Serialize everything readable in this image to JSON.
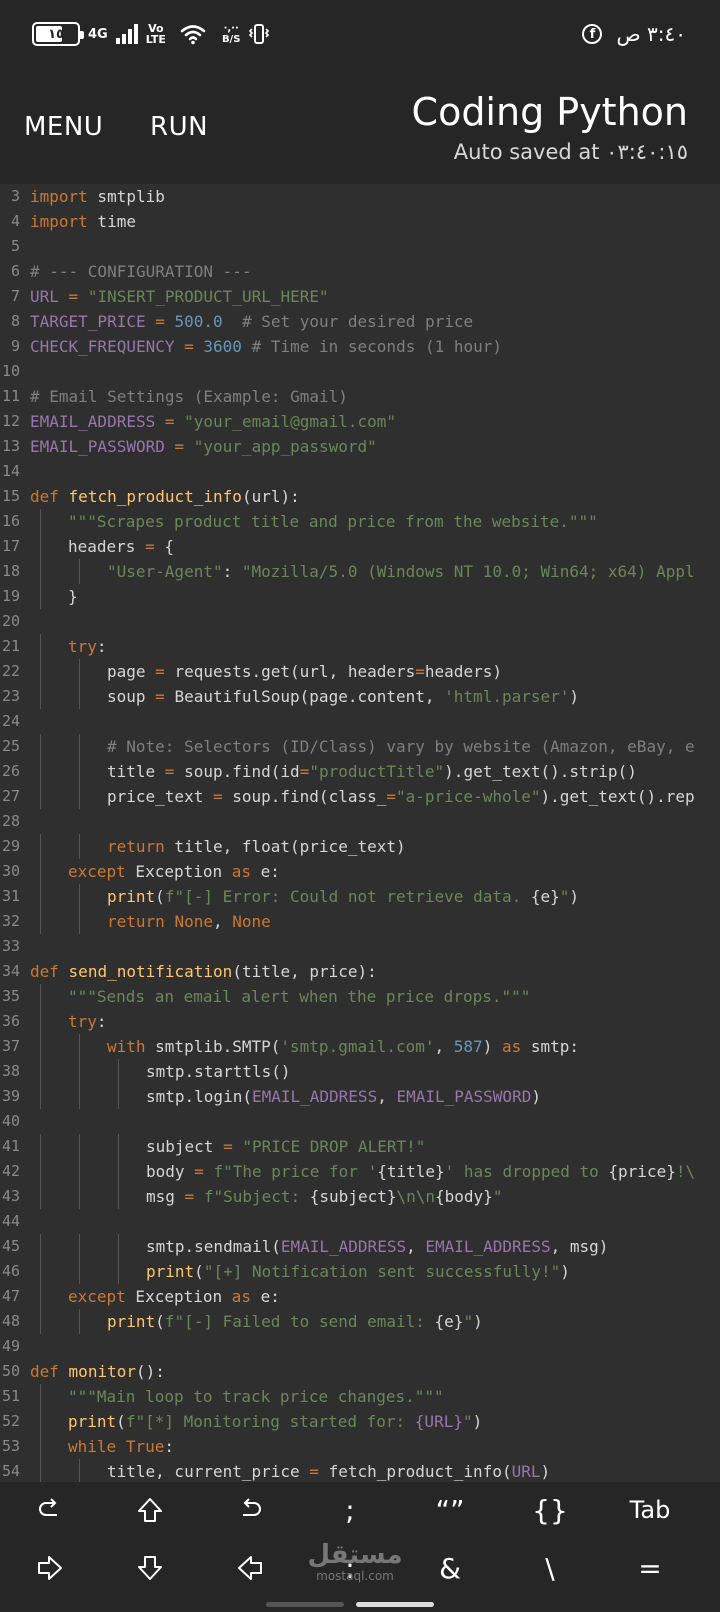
{
  "status_bar": {
    "battery": "١٥",
    "network": "4G",
    "volte_top": "Vo",
    "volte_bottom": "LTE",
    "speed_top": "·,··",
    "speed_bottom": "B/S",
    "time": "٣:٤٠ ص"
  },
  "app_bar": {
    "menu_label": "MENU",
    "run_label": "RUN",
    "title": "Coding Python",
    "subtitle": "Auto saved at ٠٣:٤٠:١٥"
  },
  "editor": {
    "lines": [
      {
        "n": "3",
        "i": 0,
        "t": [
          [
            "kw",
            "import"
          ],
          [
            "p",
            " smtplib"
          ]
        ]
      },
      {
        "n": "4",
        "i": 0,
        "t": [
          [
            "kw",
            "import"
          ],
          [
            "p",
            " time"
          ]
        ]
      },
      {
        "n": "5",
        "i": 0,
        "t": []
      },
      {
        "n": "6",
        "i": 0,
        "t": [
          [
            "cm",
            "# --- CONFIGURATION ---"
          ]
        ]
      },
      {
        "n": "7",
        "i": 0,
        "t": [
          [
            "const",
            "URL"
          ],
          [
            "op",
            " = "
          ],
          [
            "str",
            "\"INSERT_PRODUCT_URL_HERE\""
          ]
        ]
      },
      {
        "n": "8",
        "i": 0,
        "t": [
          [
            "const",
            "TARGET_PRICE"
          ],
          [
            "op",
            " = "
          ],
          [
            "num",
            "500.0"
          ],
          [
            "cm",
            "  # Set your desired price"
          ]
        ]
      },
      {
        "n": "9",
        "i": 0,
        "t": [
          [
            "const",
            "CHECK_FREQUENCY"
          ],
          [
            "op",
            " = "
          ],
          [
            "num",
            "3600"
          ],
          [
            "cm",
            " # Time in seconds (1 hour)"
          ]
        ]
      },
      {
        "n": "10",
        "i": 0,
        "t": []
      },
      {
        "n": "11",
        "i": 0,
        "t": [
          [
            "cm",
            "# Email Settings (Example: Gmail)"
          ]
        ]
      },
      {
        "n": "12",
        "i": 0,
        "t": [
          [
            "const",
            "EMAIL_ADDRESS"
          ],
          [
            "op",
            " = "
          ],
          [
            "str",
            "\"your_email@gmail.com\""
          ]
        ]
      },
      {
        "n": "13",
        "i": 0,
        "t": [
          [
            "const",
            "EMAIL_PASSWORD"
          ],
          [
            "op",
            " = "
          ],
          [
            "str",
            "\"your_app_password\""
          ]
        ]
      },
      {
        "n": "14",
        "i": 0,
        "t": []
      },
      {
        "n": "15",
        "i": 0,
        "t": [
          [
            "kw",
            "def"
          ],
          [
            "p",
            " "
          ],
          [
            "fn",
            "fetch_product_info"
          ],
          [
            "p",
            "(url):"
          ]
        ]
      },
      {
        "n": "16",
        "i": 1,
        "t": [
          [
            "str",
            "\"\"\"Scrapes product title and price from the website.\"\"\""
          ]
        ]
      },
      {
        "n": "17",
        "i": 1,
        "t": [
          [
            "p",
            "headers"
          ],
          [
            "op",
            " = "
          ],
          [
            "p",
            "{"
          ]
        ]
      },
      {
        "n": "18",
        "i": 2,
        "t": [
          [
            "str",
            "\"User-Agent\""
          ],
          [
            "p",
            ": "
          ],
          [
            "str",
            "\"Mozilla/5.0 (Windows NT 10.0; Win64; x64) Appl"
          ]
        ]
      },
      {
        "n": "19",
        "i": 1,
        "t": [
          [
            "p",
            "}"
          ]
        ]
      },
      {
        "n": "20",
        "i": 0,
        "t": []
      },
      {
        "n": "21",
        "i": 1,
        "t": [
          [
            "kw",
            "try"
          ],
          [
            "p",
            ":"
          ]
        ]
      },
      {
        "n": "22",
        "i": 2,
        "t": [
          [
            "p",
            "page"
          ],
          [
            "op",
            " = "
          ],
          [
            "p",
            "requests.get(url, headers"
          ],
          [
            "op",
            "="
          ],
          [
            "p",
            "headers)"
          ]
        ]
      },
      {
        "n": "23",
        "i": 2,
        "t": [
          [
            "p",
            "soup"
          ],
          [
            "op",
            " = "
          ],
          [
            "p",
            "BeautifulSoup(page.content, "
          ],
          [
            "str",
            "'html.parser'"
          ],
          [
            "p",
            ")"
          ]
        ]
      },
      {
        "n": "24",
        "i": 0,
        "t": []
      },
      {
        "n": "25",
        "i": 2,
        "t": [
          [
            "cm",
            "# Note: Selectors (ID/Class) vary by website (Amazon, eBay, e"
          ]
        ]
      },
      {
        "n": "26",
        "i": 2,
        "t": [
          [
            "p",
            "title"
          ],
          [
            "op",
            " = "
          ],
          [
            "p",
            "soup.find(id"
          ],
          [
            "op",
            "="
          ],
          [
            "str",
            "\"productTitle\""
          ],
          [
            "p",
            ").get_text().strip()"
          ]
        ]
      },
      {
        "n": "27",
        "i": 2,
        "t": [
          [
            "p",
            "price_text"
          ],
          [
            "op",
            " = "
          ],
          [
            "p",
            "soup.find(class_"
          ],
          [
            "op",
            "="
          ],
          [
            "str",
            "\"a-price-whole\""
          ],
          [
            "p",
            ").get_text().rep"
          ]
        ]
      },
      {
        "n": "28",
        "i": 0,
        "t": []
      },
      {
        "n": "29",
        "i": 2,
        "t": [
          [
            "kw",
            "return"
          ],
          [
            "p",
            " title, float(price_text)"
          ]
        ]
      },
      {
        "n": "30",
        "i": 1,
        "t": [
          [
            "kw",
            "except"
          ],
          [
            "p",
            " Exception "
          ],
          [
            "kw",
            "as"
          ],
          [
            "p",
            " e:"
          ]
        ]
      },
      {
        "n": "31",
        "i": 2,
        "t": [
          [
            "fn",
            "print"
          ],
          [
            "p",
            "("
          ],
          [
            "str",
            "f\"[-] Error: Could not retrieve data. "
          ],
          [
            "p",
            "{e}"
          ],
          [
            "str",
            "\""
          ],
          [
            "p",
            ")"
          ]
        ]
      },
      {
        "n": "32",
        "i": 2,
        "t": [
          [
            "kw",
            "return"
          ],
          [
            "p",
            " "
          ],
          [
            "kw",
            "None"
          ],
          [
            "p",
            ", "
          ],
          [
            "kw",
            "None"
          ]
        ]
      },
      {
        "n": "33",
        "i": 0,
        "t": []
      },
      {
        "n": "34",
        "i": 0,
        "t": [
          [
            "kw",
            "def"
          ],
          [
            "p",
            " "
          ],
          [
            "fn",
            "send_notification"
          ],
          [
            "p",
            "(title, price):"
          ]
        ]
      },
      {
        "n": "35",
        "i": 1,
        "t": [
          [
            "str",
            "\"\"\"Sends an email alert when the price drops.\"\"\""
          ]
        ]
      },
      {
        "n": "36",
        "i": 1,
        "t": [
          [
            "kw",
            "try"
          ],
          [
            "p",
            ":"
          ]
        ]
      },
      {
        "n": "37",
        "i": 2,
        "t": [
          [
            "kw",
            "with"
          ],
          [
            "p",
            " smtplib.SMTP("
          ],
          [
            "str",
            "'smtp.gmail.com'"
          ],
          [
            "p",
            ", "
          ],
          [
            "num",
            "587"
          ],
          [
            "p",
            ") "
          ],
          [
            "kw",
            "as"
          ],
          [
            "p",
            " smtp:"
          ]
        ]
      },
      {
        "n": "38",
        "i": 3,
        "t": [
          [
            "p",
            "smtp.starttls()"
          ]
        ]
      },
      {
        "n": "39",
        "i": 3,
        "t": [
          [
            "p",
            "smtp.login("
          ],
          [
            "const",
            "EMAIL_ADDRESS"
          ],
          [
            "p",
            ", "
          ],
          [
            "const",
            "EMAIL_PASSWORD"
          ],
          [
            "p",
            ")"
          ]
        ]
      },
      {
        "n": "40",
        "i": 0,
        "t": []
      },
      {
        "n": "41",
        "i": 3,
        "t": [
          [
            "p",
            "subject"
          ],
          [
            "op",
            " = "
          ],
          [
            "str",
            "\"PRICE DROP ALERT!\""
          ]
        ]
      },
      {
        "n": "42",
        "i": 3,
        "t": [
          [
            "p",
            "body"
          ],
          [
            "op",
            " = "
          ],
          [
            "str",
            "f\"The price for '"
          ],
          [
            "p",
            "{title}"
          ],
          [
            "str",
            "' has dropped to "
          ],
          [
            "p",
            "{price}"
          ],
          [
            "str",
            "!\\"
          ]
        ]
      },
      {
        "n": "43",
        "i": 3,
        "t": [
          [
            "p",
            "msg"
          ],
          [
            "op",
            " = "
          ],
          [
            "str",
            "f\"Subject: "
          ],
          [
            "p",
            "{subject}"
          ],
          [
            "str",
            "\\n\\n"
          ],
          [
            "p",
            "{body}"
          ],
          [
            "str",
            "\""
          ]
        ]
      },
      {
        "n": "44",
        "i": 0,
        "t": []
      },
      {
        "n": "45",
        "i": 3,
        "t": [
          [
            "p",
            "smtp.sendmail("
          ],
          [
            "const",
            "EMAIL_ADDRESS"
          ],
          [
            "p",
            ", "
          ],
          [
            "const",
            "EMAIL_ADDRESS"
          ],
          [
            "p",
            ", msg)"
          ]
        ]
      },
      {
        "n": "46",
        "i": 3,
        "t": [
          [
            "fn",
            "print"
          ],
          [
            "p",
            "("
          ],
          [
            "str",
            "\"[+] Notification sent successfully!\""
          ],
          [
            "p",
            ")"
          ]
        ]
      },
      {
        "n": "47",
        "i": 1,
        "t": [
          [
            "kw",
            "except"
          ],
          [
            "p",
            " Exception "
          ],
          [
            "kw",
            "as"
          ],
          [
            "p",
            " e:"
          ]
        ]
      },
      {
        "n": "48",
        "i": 2,
        "t": [
          [
            "fn",
            "print"
          ],
          [
            "p",
            "("
          ],
          [
            "str",
            "f\"[-] Failed to send email: "
          ],
          [
            "p",
            "{e}"
          ],
          [
            "str",
            "\""
          ],
          [
            "p",
            ")"
          ]
        ]
      },
      {
        "n": "49",
        "i": 0,
        "t": []
      },
      {
        "n": "50",
        "i": 0,
        "t": [
          [
            "kw",
            "def"
          ],
          [
            "p",
            " "
          ],
          [
            "fn",
            "monitor"
          ],
          [
            "p",
            "():"
          ]
        ]
      },
      {
        "n": "51",
        "i": 1,
        "t": [
          [
            "str",
            "\"\"\"Main loop to track price changes.\"\"\""
          ]
        ]
      },
      {
        "n": "52",
        "i": 1,
        "t": [
          [
            "fn",
            "print"
          ],
          [
            "p",
            "("
          ],
          [
            "str",
            "f\"[*] Monitoring started for: "
          ],
          [
            "const",
            "{URL}"
          ],
          [
            "str",
            "\""
          ],
          [
            "p",
            ")"
          ]
        ]
      },
      {
        "n": "53",
        "i": 1,
        "t": [
          [
            "kw",
            "while"
          ],
          [
            "p",
            " "
          ],
          [
            "kw",
            "True"
          ],
          [
            "p",
            ":"
          ]
        ]
      },
      {
        "n": "54",
        "i": 2,
        "t": [
          [
            "p",
            "title, current_price"
          ],
          [
            "op",
            " = "
          ],
          [
            "p",
            "fetch_product_info("
          ],
          [
            "const",
            "URL"
          ],
          [
            "p",
            ")"
          ]
        ]
      }
    ]
  },
  "toolbar": {
    "row1": [
      {
        "name": "redo-key",
        "icon": "redo-icon",
        "label": ""
      },
      {
        "name": "shift-up-key",
        "icon": "arrow-up-icon",
        "label": ""
      },
      {
        "name": "undo-key",
        "icon": "undo-icon",
        "label": ""
      },
      {
        "name": "semicolon-key",
        "icon": "",
        "label": ";"
      },
      {
        "name": "quotes-key",
        "icon": "",
        "label": "“”"
      },
      {
        "name": "braces-key",
        "icon": "",
        "label": "{}"
      },
      {
        "name": "tab-key",
        "icon": "",
        "label": "Tab"
      }
    ],
    "row2": [
      {
        "name": "arrow-right-key",
        "icon": "arrow-right-icon",
        "label": ""
      },
      {
        "name": "arrow-down-key",
        "icon": "arrow-down-icon",
        "label": ""
      },
      {
        "name": "arrow-left-key",
        "icon": "arrow-left-icon",
        "label": ""
      },
      {
        "name": "colon-key",
        "icon": "",
        "label": ":"
      },
      {
        "name": "ampersand-key",
        "icon": "",
        "label": "&"
      },
      {
        "name": "backslash-key",
        "icon": "",
        "label": "\\"
      },
      {
        "name": "equals-key",
        "icon": "",
        "label": "="
      }
    ]
  },
  "watermark": {
    "arabic": "مستقل",
    "latin": "mostaql.com"
  },
  "colors": {
    "keyword": "#cc7832",
    "string": "#6a8759",
    "comment": "#7f7f7f",
    "number": "#6897bb",
    "constant": "#9876aa",
    "function": "#ffc66d",
    "editor_bg": "#2f2f2f",
    "bar_bg": "#262626"
  }
}
